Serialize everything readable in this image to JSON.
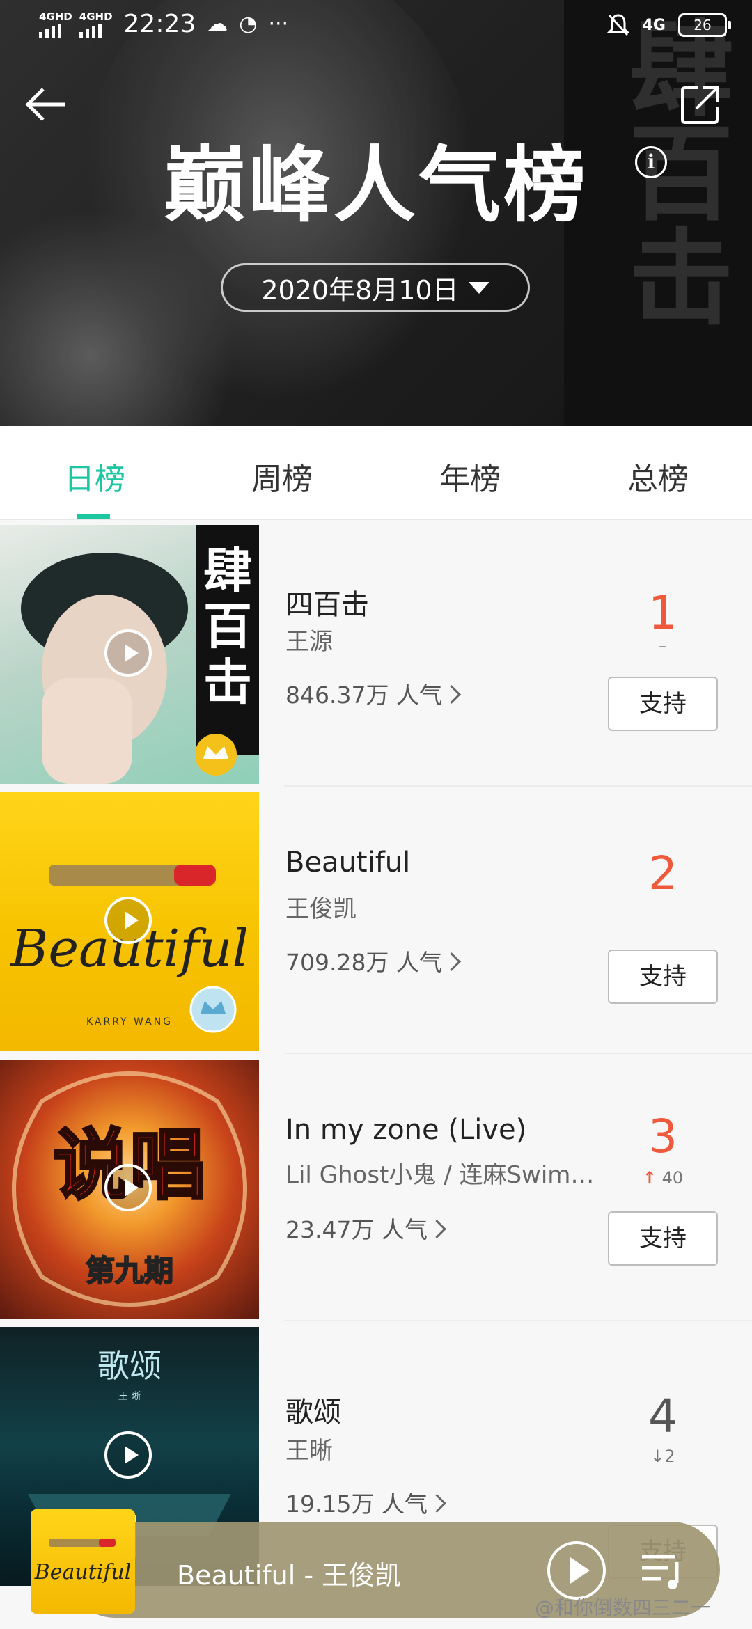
{
  "status_bar": {
    "net1": "4GHD",
    "net2": "4GHD",
    "time": "22:23",
    "net3": "4G",
    "battery": "26"
  },
  "header": {
    "title": "巅峰人气榜",
    "date": "2020年8月10日",
    "strip_text": "肆百击"
  },
  "tabs": [
    "日榜",
    "周榜",
    "年榜",
    "总榜"
  ],
  "active_tab": "日榜",
  "rows": [
    {
      "song": "四百击",
      "artist": "王源",
      "popularity": "846.37万 人气",
      "rank": "1",
      "trend": "–",
      "support": "支持"
    },
    {
      "song": "Beautiful",
      "artist": "王俊凯",
      "popularity": "709.28万 人气",
      "rank": "2",
      "trend": "",
      "support": "支持"
    },
    {
      "song": "In my zone (Live)",
      "artist": "Lil Ghost小鬼 / 连麻Swim…",
      "popularity": "23.47万 人气",
      "rank": "3",
      "trend": "40",
      "support": "支持"
    },
    {
      "song": "歌颂",
      "artist": "王晰",
      "popularity": "19.15万 人气",
      "rank": "4",
      "trend": "2",
      "support": "支持"
    }
  ],
  "covers": {
    "c2_text": "Beautiful",
    "c2_sub": "KARRY WANG",
    "c3_text": "第九期",
    "c4_title": "歌颂",
    "c4_sub": "王 晰"
  },
  "player": {
    "now_playing": "Beautiful - 王俊凯",
    "art_text": "Beautiful"
  },
  "watermark": "@和你倒数四三二一",
  "colors": {
    "accent": "#1cc6a0",
    "rank_red": "#f05a3c"
  }
}
